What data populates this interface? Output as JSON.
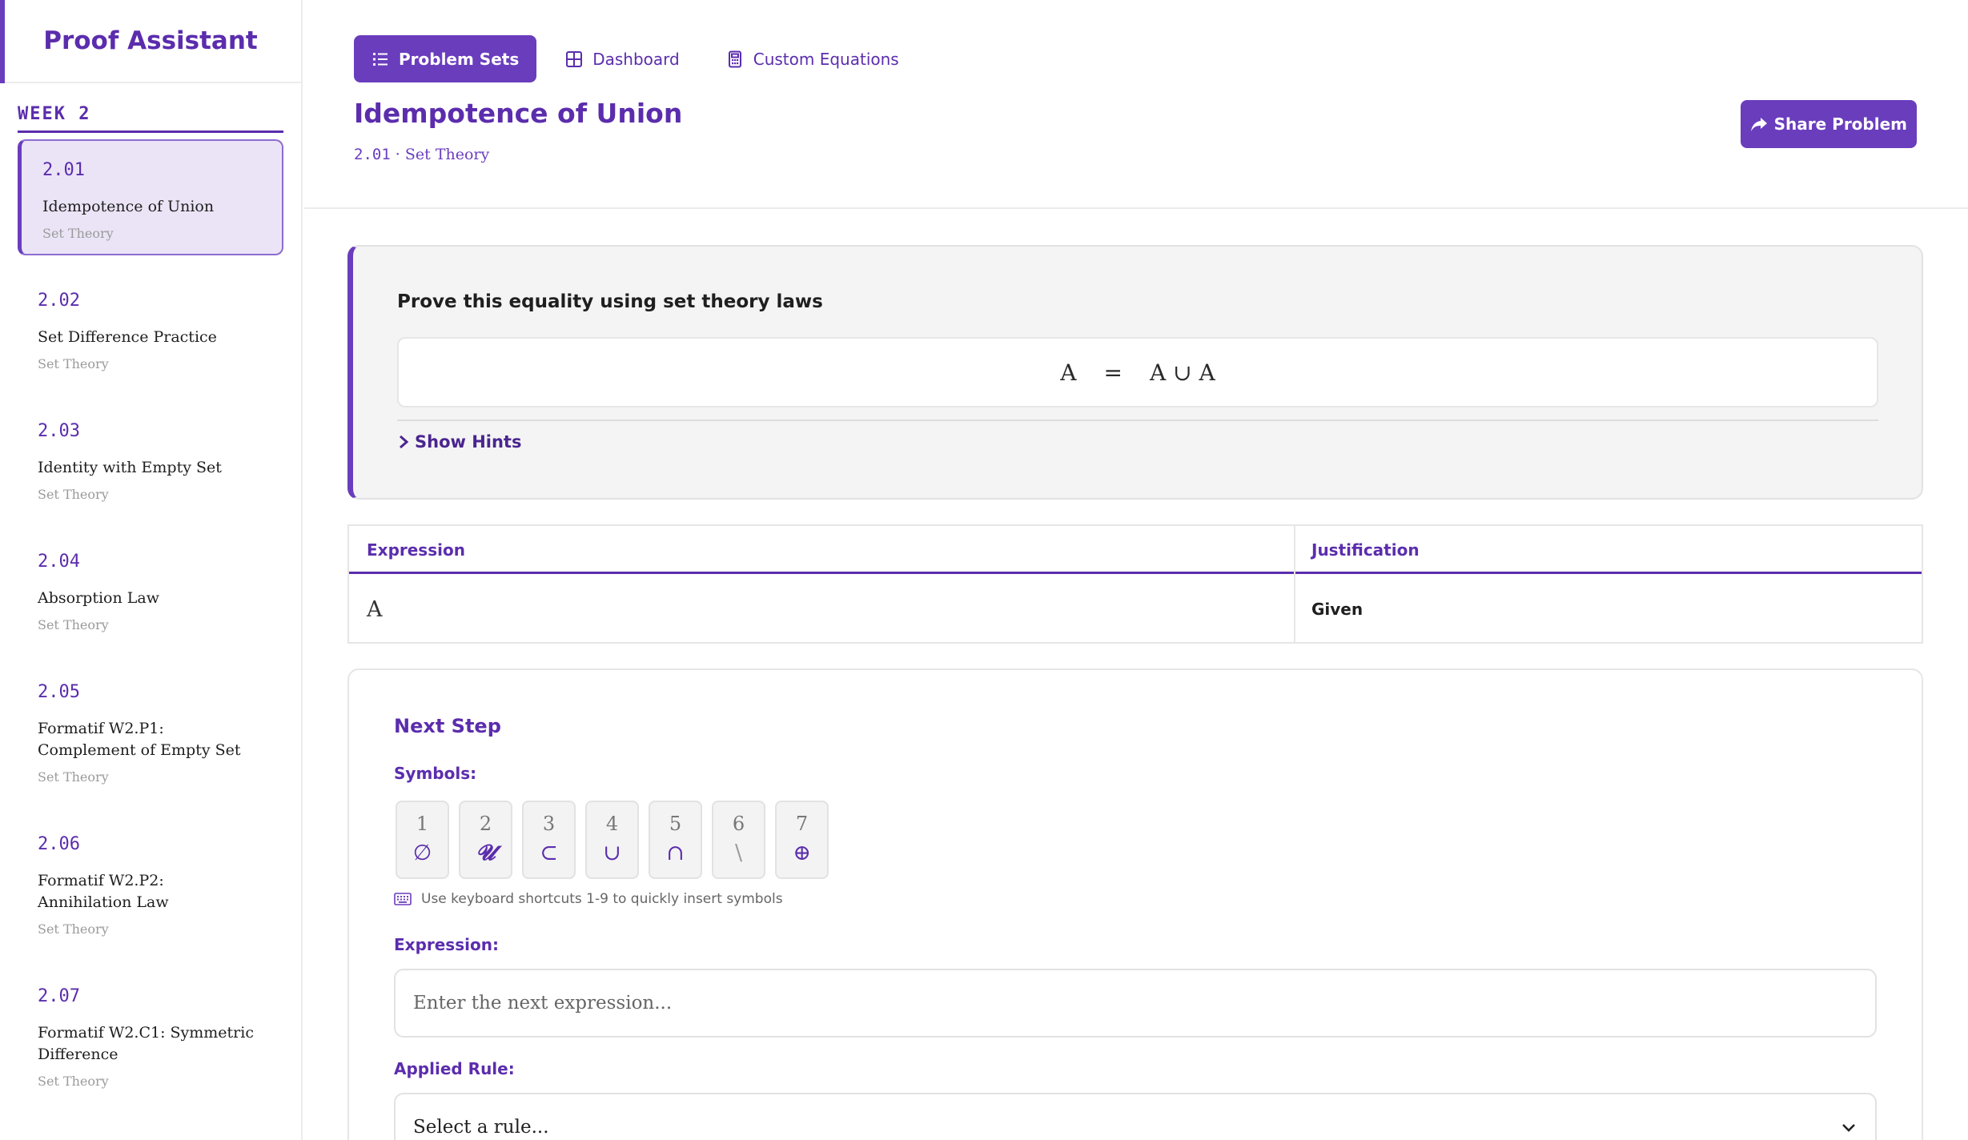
{
  "app": {
    "title": "Proof Assistant"
  },
  "sidebar": {
    "week_label": "WEEK 2",
    "problems": [
      {
        "number": "2.01",
        "title": "Idempotence of Union",
        "category": "Set Theory",
        "active": true
      },
      {
        "number": "2.02",
        "title": "Set Difference Practice",
        "category": "Set Theory"
      },
      {
        "number": "2.03",
        "title": "Identity with Empty Set",
        "category": "Set Theory"
      },
      {
        "number": "2.04",
        "title": "Absorption Law",
        "category": "Set Theory"
      },
      {
        "number": "2.05",
        "title": "Formatif W2.P1: Complement of Empty Set",
        "category": "Set Theory"
      },
      {
        "number": "2.06",
        "title": "Formatif W2.P2: Annihilation Law",
        "category": "Set Theory"
      },
      {
        "number": "2.07",
        "title": "Formatif W2.C1: Symmetric Difference",
        "category": "Set Theory"
      }
    ]
  },
  "nav": {
    "problem_sets": "Problem Sets",
    "dashboard": "Dashboard",
    "custom_equations": "Custom Equations"
  },
  "header": {
    "title": "Idempotence of Union",
    "crumb_number": "2.01",
    "crumb_sep": " · ",
    "crumb_category": "Set Theory",
    "share_label": "Share Problem"
  },
  "prove": {
    "heading": "Prove this equality using set theory laws",
    "lhs": "A",
    "eq": "=",
    "rhs": "A ∪ A",
    "hints_label": "Show Hints"
  },
  "table": {
    "col_expression": "Expression",
    "col_justification": "Justification",
    "rows": [
      {
        "expression": "A",
        "justification": "Given"
      }
    ]
  },
  "next_step": {
    "title": "Next Step",
    "symbols_label": "Symbols:",
    "symbols": [
      {
        "key": "1",
        "glyph": "∅"
      },
      {
        "key": "2",
        "glyph": "𝓤"
      },
      {
        "key": "3",
        "glyph": "⊂"
      },
      {
        "key": "4",
        "glyph": "∪"
      },
      {
        "key": "5",
        "glyph": "∩"
      },
      {
        "key": "6",
        "glyph": "\\"
      },
      {
        "key": "7",
        "glyph": "⊕"
      }
    ],
    "shortcut_hint": "Use keyboard shortcuts 1-9 to quickly insert symbols",
    "expression_label": "Expression:",
    "expression_placeholder": "Enter the next expression...",
    "rule_label": "Applied Rule:",
    "rule_selected": "Select a rule..."
  },
  "colors": {
    "accent": "#6a3dbd",
    "accent_dark": "#5b2dad",
    "active_bg": "#ebe4f6"
  },
  "icons": {
    "problem_sets": "list-icon",
    "dashboard": "grid-icon",
    "custom_equations": "calculator-icon",
    "share": "share-arrow-icon",
    "hints": "chevron-right-icon",
    "keyboard": "keyboard-icon",
    "select": "chevron-down-icon"
  }
}
